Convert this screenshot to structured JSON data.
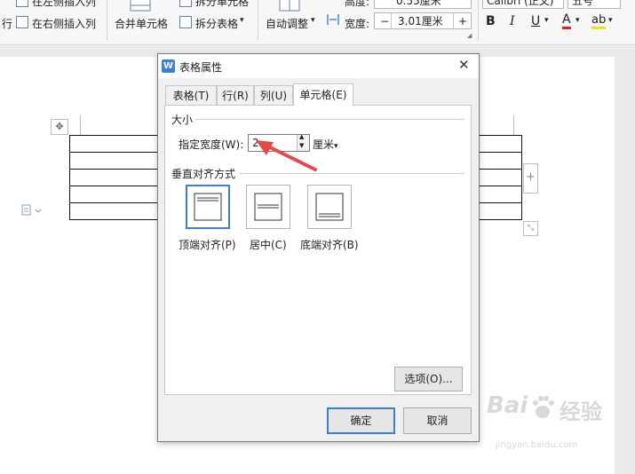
{
  "ribbon": {
    "insert_left_partial": "在左侧插入列",
    "insert_right": "在右侧插入列",
    "row_partial": "行",
    "merge_cells": "合并单元格",
    "split_cells_partial": "拆分单元格",
    "split_table": "拆分表格",
    "auto_adjust": "自动调整",
    "height_label": "高度:",
    "height_value": "0.55厘米",
    "width_label": "宽度:",
    "width_value": "3.01厘米",
    "minus": "−",
    "plus": "+",
    "font_name": "Calibri (正文)",
    "font_size": "五号",
    "bold": "B",
    "italic": "I",
    "underline": "U",
    "font_color": "A",
    "highlight": "ab"
  },
  "dialog": {
    "title": "表格属性",
    "tabs": [
      "表格(T)",
      "行(R)",
      "列(U)",
      "单元格(E)"
    ],
    "size_group": "大小",
    "width_label": "指定宽度(W):",
    "width_value": "2",
    "unit": "厘米",
    "valign_group": "垂直对齐方式",
    "align_options": [
      "顶端对齐(P)",
      "居中(C)",
      "底端对齐(B)"
    ],
    "options_button": "选项(O)...",
    "ok_button": "确定",
    "cancel_button": "取消"
  },
  "watermark": {
    "line1": "Bai",
    "line2": "经验",
    "url": "jingyan.baidu.com"
  },
  "colors": {
    "accent": "#3d7fd8",
    "arrow": "#e8474a",
    "font_color_bar": "#e02020",
    "highlight_bar": "#f0e020"
  }
}
